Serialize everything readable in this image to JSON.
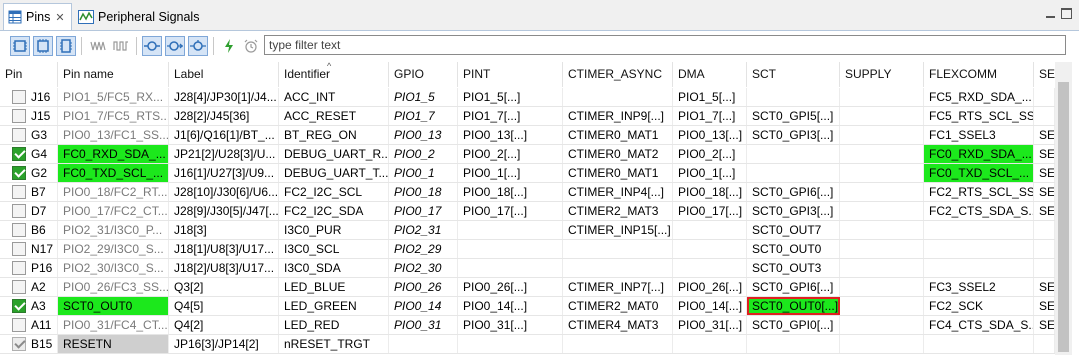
{
  "tabs": [
    {
      "label": "Pins",
      "icon": "table-icon",
      "active": true
    },
    {
      "label": "Peripheral Signals",
      "icon": "waveform-icon",
      "active": false
    }
  ],
  "toolbar": {
    "filter_placeholder": "type filter text",
    "buttons": [
      "show-pins-icon",
      "show-pins-both-icon",
      "show-pins-routed-icon",
      "signal-icon",
      "signal-bus-icon",
      "route-icon",
      "route-right-icon",
      "route-cycle-icon",
      "lightning-icon",
      "alarm-clock-icon"
    ]
  },
  "columns": [
    "Pin",
    "Pin name",
    "Label",
    "Identifier",
    "GPIO",
    "PINT",
    "CTIMER_ASYNC",
    "DMA",
    "SCT",
    "SUPPLY",
    "FLEXCOMM",
    "SE"
  ],
  "rows": [
    {
      "check": "off",
      "pin": "J16",
      "name": "PIO1_5/FC5_RX...",
      "label": "J28[4]/JP30[1]/J4...",
      "id": "ACC_INT",
      "gpio": "PIO1_5",
      "pint": "PIO1_5[...]",
      "ctimer": "",
      "dma": "PIO1_5[...]",
      "sct": "",
      "supply": "",
      "flex": "FC5_RXD_SDA_...",
      "se": ""
    },
    {
      "check": "off",
      "pin": "J15",
      "name": "PIO1_7/FC5_RTS...",
      "label": "J28[2]/J45[36]",
      "id": "ACC_RESET",
      "gpio": "PIO1_7",
      "pint": "PIO1_7[...]",
      "ctimer": "CTIMER_INP9[...]",
      "dma": "PIO1_7[...]",
      "sct": "SCT0_GPI5[...]",
      "supply": "",
      "flex": "FC5_RTS_SCL_SS...",
      "se": ""
    },
    {
      "check": "off",
      "pin": "G3",
      "name": "PIO0_13/FC1_SS...",
      "label": "J1[6]/Q16[1]/BT_...",
      "id": "BT_REG_ON",
      "gpio": "PIO0_13",
      "pint": "PIO0_13[...]",
      "ctimer": "CTIMER0_MAT1",
      "dma": "PIO0_13[...]",
      "sct": "SCT0_GPI3[...]",
      "supply": "",
      "flex": "FC1_SSEL3",
      "se": "SE"
    },
    {
      "check": "on",
      "pin": "G4",
      "name": "FC0_RXD_SDA_...",
      "label": "JP21[2]/U28[3]/U...",
      "id": "DEBUG_UART_R...",
      "gpio": "PIO0_2",
      "pint": "PIO0_2[...]",
      "ctimer": "CTIMER0_MAT2",
      "dma": "PIO0_2[...]",
      "sct": "",
      "supply": "",
      "flex": "FC0_RXD_SDA_...",
      "se": "SE",
      "hl": "green"
    },
    {
      "check": "on",
      "pin": "G2",
      "name": "FC0_TXD_SCL_...",
      "label": "J16[1]/U27[3]/U9...",
      "id": "DEBUG_UART_T...",
      "gpio": "PIO0_1",
      "pint": "PIO0_1[...]",
      "ctimer": "CTIMER0_MAT1",
      "dma": "PIO0_1[...]",
      "sct": "",
      "supply": "",
      "flex": "FC0_TXD_SCL_...",
      "se": "SE",
      "hl": "green"
    },
    {
      "check": "off",
      "pin": "B7",
      "name": "PIO0_18/FC2_RT...",
      "label": "J28[10]/J30[6]/U6...",
      "id": "FC2_I2C_SCL",
      "gpio": "PIO0_18",
      "pint": "PIO0_18[...]",
      "ctimer": "CTIMER_INP4[...]",
      "dma": "PIO0_18[...]",
      "sct": "SCT0_GPI6[...]",
      "supply": "",
      "flex": "FC2_RTS_SCL_SS...",
      "se": "SE"
    },
    {
      "check": "off",
      "pin": "D7",
      "name": "PIO0_17/FC2_CT...",
      "label": "J28[9]/J30[5]/J47[...",
      "id": "FC2_I2C_SDA",
      "gpio": "PIO0_17",
      "pint": "PIO0_17[...]",
      "ctimer": "CTIMER2_MAT3",
      "dma": "PIO0_17[...]",
      "sct": "SCT0_GPI3[...]",
      "supply": "",
      "flex": "FC2_CTS_SDA_S...",
      "se": "SE"
    },
    {
      "check": "off",
      "pin": "B6",
      "name": "PIO2_31/I3C0_P...",
      "label": "J18[3]",
      "id": "I3C0_PUR",
      "gpio": "PIO2_31",
      "pint": "",
      "ctimer": "CTIMER_INP15[...]",
      "dma": "",
      "sct": "SCT0_OUT7",
      "supply": "",
      "flex": "",
      "se": ""
    },
    {
      "check": "off",
      "pin": "N17",
      "name": "PIO2_29/I3C0_S...",
      "label": "J18[1]/U8[3]/U17...",
      "id": "I3C0_SCL",
      "gpio": "PIO2_29",
      "pint": "",
      "ctimer": "",
      "dma": "",
      "sct": "SCT0_OUT0",
      "supply": "",
      "flex": "",
      "se": ""
    },
    {
      "check": "off",
      "pin": "P16",
      "name": "PIO2_30/I3C0_S...",
      "label": "J18[2]/U8[3]/U17...",
      "id": "I3C0_SDA",
      "gpio": "PIO2_30",
      "pint": "",
      "ctimer": "",
      "dma": "",
      "sct": "SCT0_OUT3",
      "supply": "",
      "flex": "",
      "se": ""
    },
    {
      "check": "off",
      "pin": "A2",
      "name": "PIO0_26/FC3_SS...",
      "label": "Q3[2]",
      "id": "LED_BLUE",
      "gpio": "PIO0_26",
      "pint": "PIO0_26[...]",
      "ctimer": "CTIMER_INP7[...]",
      "dma": "PIO0_26[...]",
      "sct": "SCT0_GPI6[...]",
      "supply": "",
      "flex": "FC3_SSEL2",
      "se": "SE"
    },
    {
      "check": "on",
      "pin": "A3",
      "name": "SCT0_OUT0",
      "label": "Q4[5]",
      "id": "LED_GREEN",
      "gpio": "PIO0_14",
      "pint": "PIO0_14[...]",
      "ctimer": "CTIMER2_MAT0",
      "dma": "PIO0_14[...]",
      "sct": "SCT0_OUT0[...]",
      "supply": "",
      "flex": "FC2_SCK",
      "se": "SE",
      "hl": "sct"
    },
    {
      "check": "off",
      "pin": "A11",
      "name": "PIO0_31/FC4_CT...",
      "label": "Q4[2]",
      "id": "LED_RED",
      "gpio": "PIO0_31",
      "pint": "PIO0_31[...]",
      "ctimer": "CTIMER4_MAT3",
      "dma": "PIO0_31[...]",
      "sct": "SCT0_GPI0[...]",
      "supply": "",
      "flex": "FC4_CTS_SDA_S...",
      "se": "SE"
    },
    {
      "check": "dis",
      "pin": "B15",
      "name": "RESETN",
      "label": "JP16[3]/JP14[2]",
      "id": "nRESET_TRGT",
      "gpio": "",
      "pint": "",
      "ctimer": "",
      "dma": "",
      "sct": "",
      "supply": "",
      "flex": "",
      "se": "",
      "hl": "gray"
    }
  ],
  "colors": {
    "green_highlight": "#1ce81c",
    "red_box": "#e02020",
    "header_border": "#b5c7dc"
  }
}
